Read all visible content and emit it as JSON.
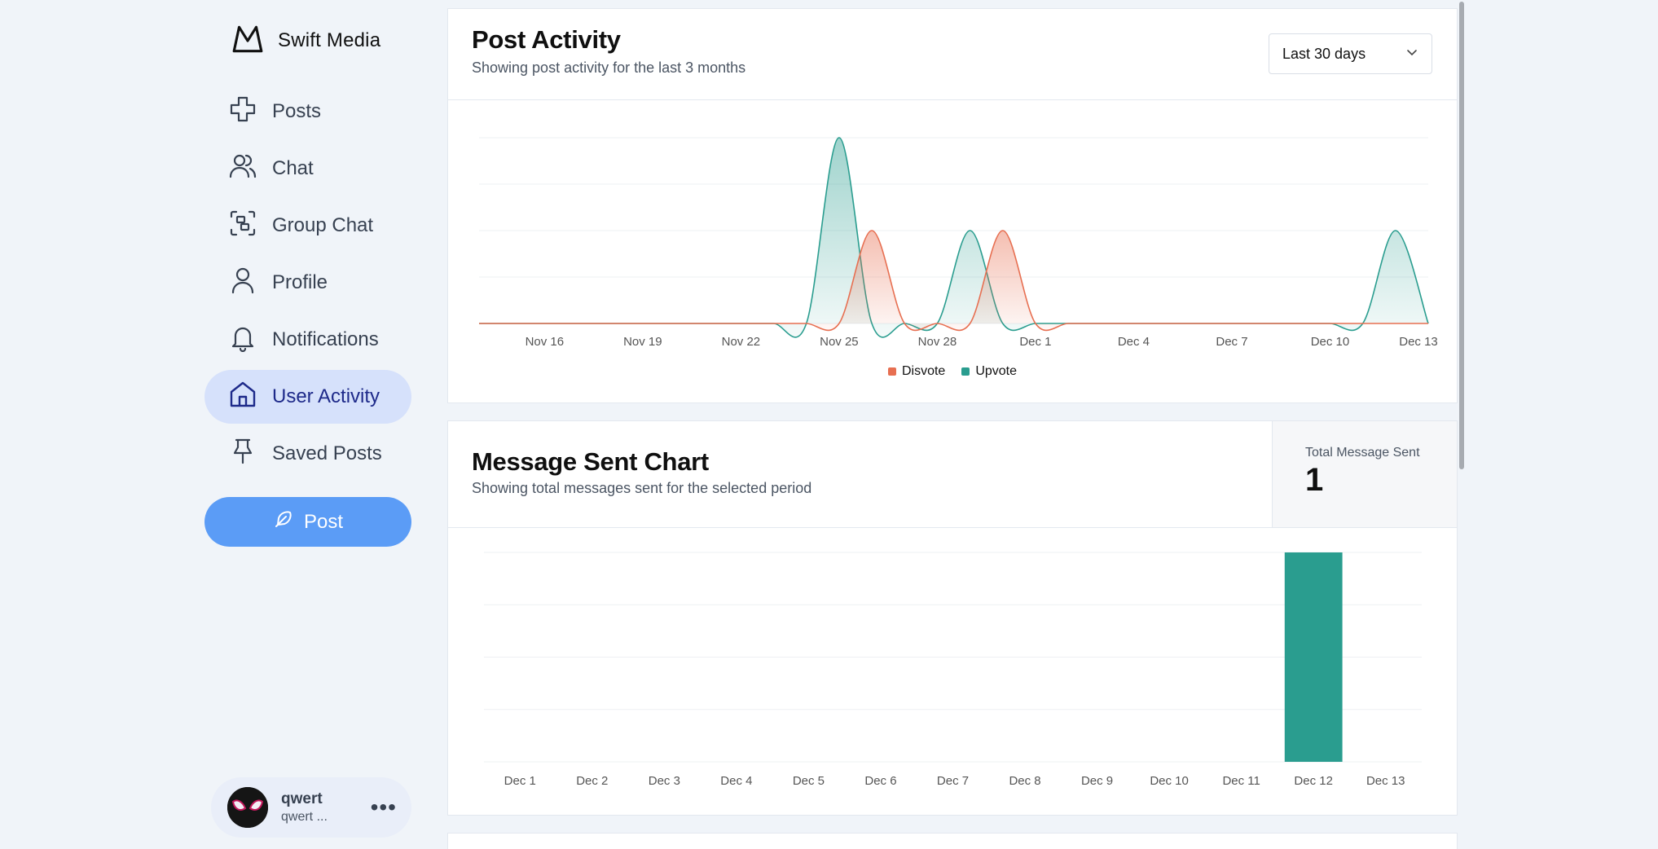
{
  "brand": {
    "name": "Swift Media",
    "logo_icon": "mountain-logo-icon"
  },
  "nav": [
    {
      "label": "Posts",
      "icon": "plus-icon",
      "active": false
    },
    {
      "label": "Chat",
      "icon": "users-icon",
      "active": false
    },
    {
      "label": "Group Chat",
      "icon": "group-icon",
      "active": false
    },
    {
      "label": "Profile",
      "icon": "person-icon",
      "active": false
    },
    {
      "label": "Notifications",
      "icon": "bell-icon",
      "active": false
    },
    {
      "label": "User Activity",
      "icon": "home-icon",
      "active": true
    },
    {
      "label": "Saved Posts",
      "icon": "pin-icon",
      "active": false
    }
  ],
  "post_button": {
    "label": "Post",
    "icon": "feather-icon"
  },
  "user": {
    "name": "qwert",
    "handle": "qwert ...",
    "avatar_icon": "mask-avatar-icon",
    "more_icon": "ellipsis-icon"
  },
  "post_activity": {
    "title": "Post Activity",
    "subtitle": "Showing post activity for the last 3 months",
    "range_selected": "Last 30 days"
  },
  "message_chart": {
    "title": "Message Sent Chart",
    "subtitle": "Showing total messages sent for the selected period",
    "total_label": "Total Message Sent",
    "total_value": "1"
  },
  "colors": {
    "upvote": "#2a9d8f",
    "disvote": "#e76f51",
    "active_nav_bg": "#d6e1fb",
    "post_button": "#5b9cf6"
  },
  "chart_data": [
    {
      "type": "area",
      "x_tick_labels": [
        "Nov 16",
        "Nov 19",
        "Nov 22",
        "Nov 25",
        "Nov 28",
        "Dec 1",
        "Dec 4",
        "Dec 7",
        "Dec 10",
        "Dec 13"
      ],
      "x": [
        "Nov 14",
        "Nov 15",
        "Nov 16",
        "Nov 17",
        "Nov 18",
        "Nov 19",
        "Nov 20",
        "Nov 21",
        "Nov 22",
        "Nov 23",
        "Nov 24",
        "Nov 25",
        "Nov 26",
        "Nov 27",
        "Nov 28",
        "Nov 29",
        "Nov 30",
        "Dec 1",
        "Dec 2",
        "Dec 3",
        "Dec 4",
        "Dec 5",
        "Dec 6",
        "Dec 7",
        "Dec 8",
        "Dec 9",
        "Dec 10",
        "Dec 11",
        "Dec 12",
        "Dec 13"
      ],
      "series": [
        {
          "name": "Disvote",
          "values": [
            0,
            0,
            0,
            0,
            0,
            0,
            0,
            0,
            0,
            0,
            0,
            0,
            2,
            0,
            0,
            0,
            2,
            0,
            0,
            0,
            0,
            0,
            0,
            0,
            0,
            0,
            0,
            0,
            0,
            0
          ]
        },
        {
          "name": "Upvote",
          "values": [
            0,
            0,
            0,
            0,
            0,
            0,
            0,
            0,
            0,
            0,
            0,
            4,
            0,
            0,
            0,
            2,
            0,
            0,
            0,
            0,
            0,
            0,
            0,
            0,
            0,
            0,
            0,
            0,
            2,
            0
          ]
        }
      ],
      "legend": "bottom-center",
      "grid": "horizontal"
    },
    {
      "type": "bar",
      "categories": [
        "Dec 1",
        "Dec 2",
        "Dec 3",
        "Dec 4",
        "Dec 5",
        "Dec 6",
        "Dec 7",
        "Dec 8",
        "Dec 9",
        "Dec 10",
        "Dec 11",
        "Dec 12",
        "Dec 13"
      ],
      "values": [
        0,
        0,
        0,
        0,
        0,
        0,
        0,
        0,
        0,
        0,
        0,
        1,
        0
      ],
      "ylim": [
        0,
        1
      ],
      "grid": "horizontal"
    }
  ]
}
